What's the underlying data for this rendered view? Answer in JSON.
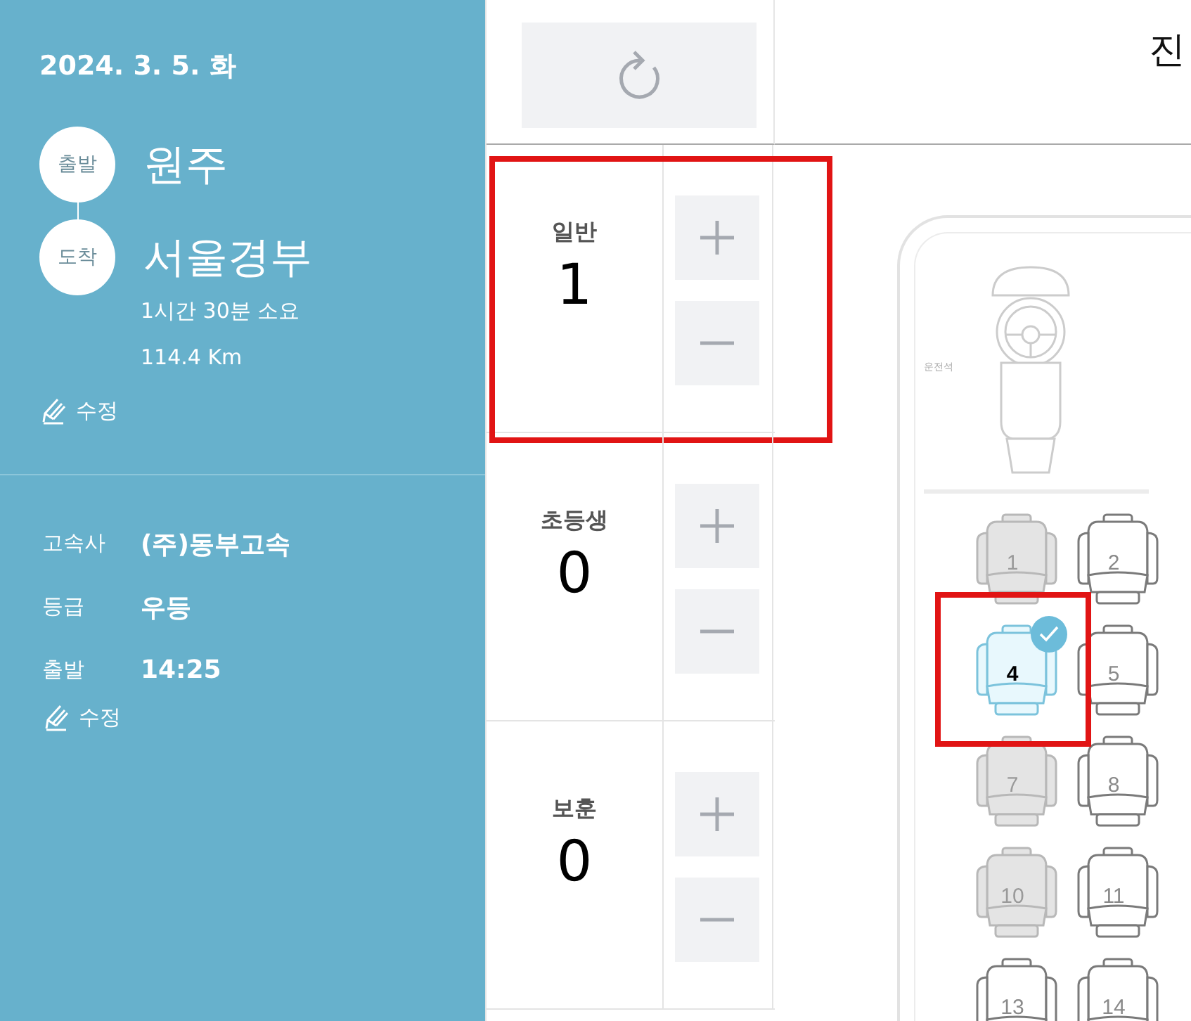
{
  "sidebar": {
    "date": "2024. 3. 5. 화",
    "route": [
      {
        "tag": "출발",
        "place": "원주"
      },
      {
        "tag": "도착",
        "place": "서울경부"
      }
    ],
    "duration": "1시간 30분 소요",
    "distance": "114.4 Km",
    "edit_route": "수정",
    "info": [
      {
        "label": "고속사",
        "value": "(주)동부고속"
      },
      {
        "label": "등급",
        "value": "우등"
      },
      {
        "label": "출발",
        "value": "14:25"
      }
    ],
    "edit_info": "수정"
  },
  "passengers": [
    {
      "label": "일반",
      "count": "1",
      "highlighted": true
    },
    {
      "label": "초등생",
      "count": "0",
      "highlighted": false
    },
    {
      "label": "보훈",
      "count": "0",
      "highlighted": false
    }
  ],
  "header": {
    "title": "진"
  },
  "bus": {
    "driver_label": "운전석",
    "seats": [
      {
        "number": "1",
        "sold": true,
        "selected": false,
        "highlighted": false
      },
      {
        "number": "2",
        "sold": false,
        "selected": false,
        "highlighted": false
      },
      {
        "number": "4",
        "sold": false,
        "selected": true,
        "highlighted": true
      },
      {
        "number": "5",
        "sold": false,
        "selected": false,
        "highlighted": false
      },
      {
        "number": "7",
        "sold": true,
        "selected": false,
        "highlighted": false
      },
      {
        "number": "8",
        "sold": false,
        "selected": false,
        "highlighted": false
      },
      {
        "number": "10",
        "sold": true,
        "selected": false,
        "highlighted": false
      },
      {
        "number": "11",
        "sold": false,
        "selected": false,
        "highlighted": false
      },
      {
        "number": "13",
        "sold": false,
        "selected": false,
        "highlighted": false
      },
      {
        "number": "14",
        "sold": false,
        "selected": false,
        "highlighted": false
      }
    ]
  }
}
